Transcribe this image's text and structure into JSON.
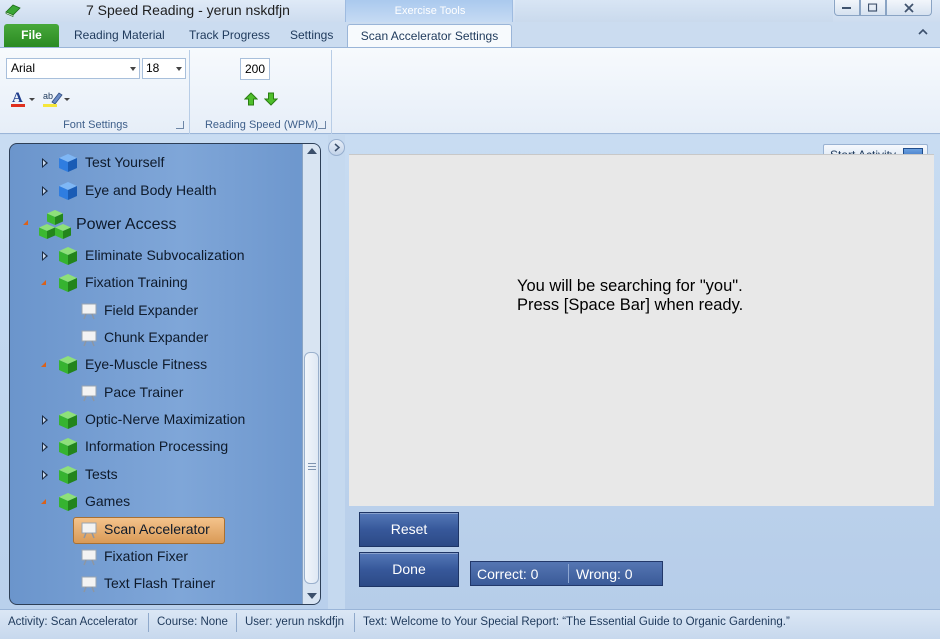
{
  "window": {
    "title": "7 Speed Reading - yerun nskdfjn",
    "context_group": "Exercise Tools"
  },
  "ribbon": {
    "tabs": {
      "file": "File",
      "reading_material": "Reading Material",
      "track_progress": "Track Progress",
      "settings": "Settings",
      "scan_settings": "Scan Accelerator Settings"
    },
    "font_group": {
      "label": "Font Settings",
      "font": "Arial",
      "size": "18"
    },
    "speed_group": {
      "label": "Reading Speed (WPM)",
      "wpm": "200"
    }
  },
  "tree": {
    "test_yourself": "Test Yourself",
    "eye_body": "Eye and Body Health",
    "power_access": "Power Access",
    "eliminate_sub": "Eliminate Subvocalization",
    "fixation_training": "Fixation Training",
    "field_expander": "Field Expander",
    "chunk_expander": "Chunk Expander",
    "eye_muscle": "Eye-Muscle Fitness",
    "pace_trainer": "Pace Trainer",
    "optic_nerve": "Optic-Nerve Maximization",
    "info_processing": "Information Processing",
    "tests": "Tests",
    "games": "Games",
    "scan_accelerator": "Scan Accelerator",
    "fixation_fixer": "Fixation Fixer",
    "text_flash": "Text Flash Trainer"
  },
  "main": {
    "start_activity": "Start Activity",
    "prompt_line1": "You will be searching for \"you\".",
    "prompt_line2": "Press [Space Bar] when ready.",
    "reset": "Reset",
    "done": "Done",
    "correct": "Correct:  0",
    "wrong": "Wrong:  0"
  },
  "status": {
    "activity": "Activity: Scan Accelerator",
    "course": "Course: None",
    "user": "User: yerun nskdfjn",
    "text": "Text: Welcome to Your Special Report: “The Essential Guide to Organic Gardening.”"
  },
  "colors": {
    "file_tab": "#2b8a22",
    "tree_bg": "#7fa6d8",
    "selected_item": "#e3a865",
    "action_button": "#37589a",
    "cube_blue": "#2f7de0",
    "cube_green": "#36b330"
  },
  "icons": {
    "app": "green-book-icon",
    "node_blue": "blue-cube-icon",
    "node_green": "green-cube-icon",
    "leaf": "exercise-icon"
  }
}
